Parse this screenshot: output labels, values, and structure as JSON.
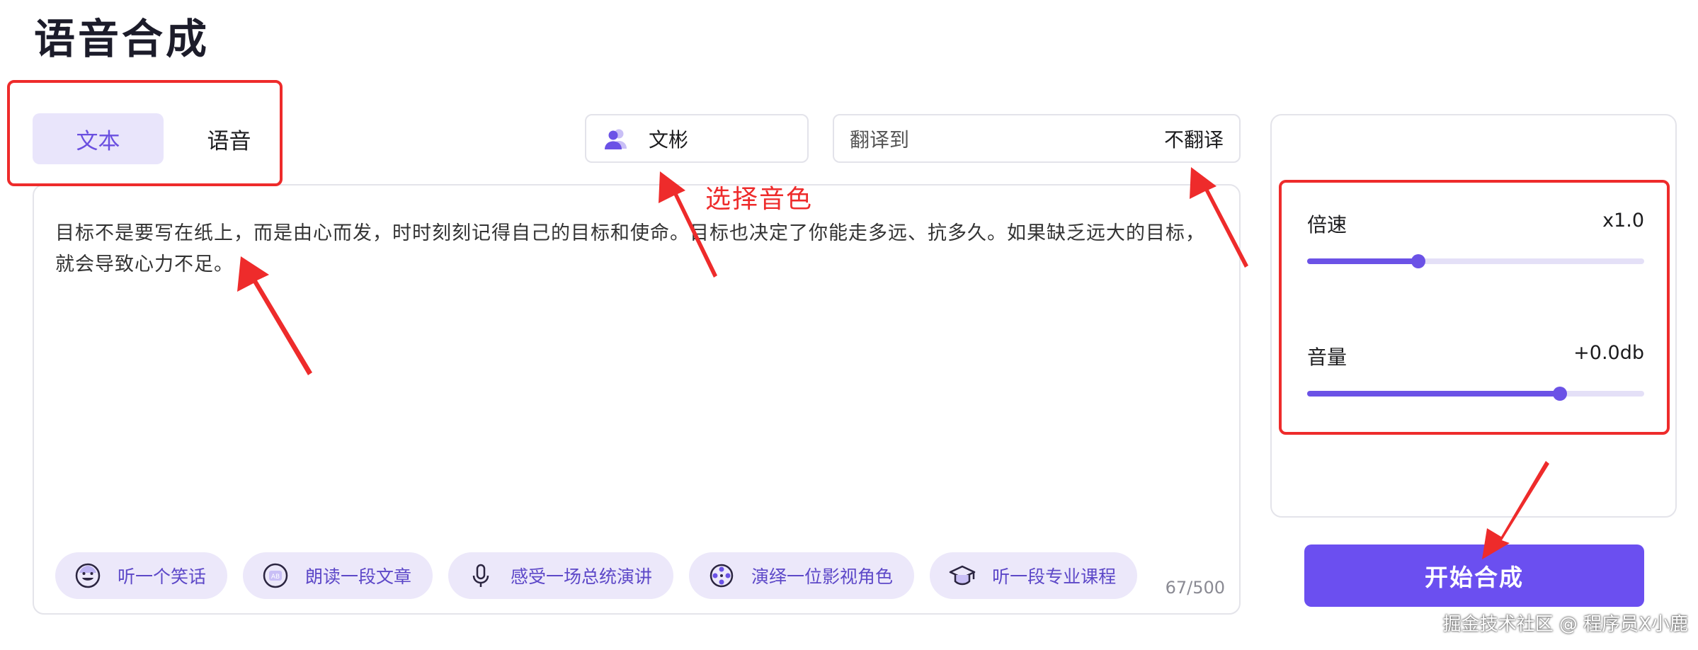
{
  "page": {
    "title": "语音合成"
  },
  "mode_tabs": [
    {
      "label": "文本",
      "active": true
    },
    {
      "label": "语音",
      "active": false
    }
  ],
  "voice_select": {
    "icon": "user-group-icon",
    "value": "文彬"
  },
  "translate_select": {
    "label": "翻译到",
    "value": "不翻译"
  },
  "editor": {
    "text": "目标不是要写在纸上，而是由心而发，时时刻刻记得自己的目标和使命。目标也决定了你能走多远、抗多久。如果缺乏远大的目标，就会导致心力不足。",
    "counter": "67/500"
  },
  "suggestion_chips": [
    {
      "label": "听一个笑话",
      "icon": "smile-icon"
    },
    {
      "label": "朗读一段文章",
      "icon": "article-icon"
    },
    {
      "label": "感受一场总统演讲",
      "icon": "microphone-icon"
    },
    {
      "label": "演绎一位影视角色",
      "icon": "film-reel-icon"
    },
    {
      "label": "听一段专业课程",
      "icon": "graduation-cap-icon"
    }
  ],
  "settings": {
    "speed": {
      "label": "倍速",
      "value": "x1.0",
      "level": 0.33
    },
    "volume": {
      "label": "音量",
      "value": "+0.0db",
      "level": 0.75
    }
  },
  "start_button": {
    "label": "开始合成"
  },
  "annotations": {
    "voice_hint": "选择音色",
    "color": "#ee2b2b"
  },
  "watermark": "掘金技术社区 @ 程序员X小鹿",
  "colors": {
    "accent": "#6b4ff0",
    "accent_light": "#e9e5fb"
  }
}
